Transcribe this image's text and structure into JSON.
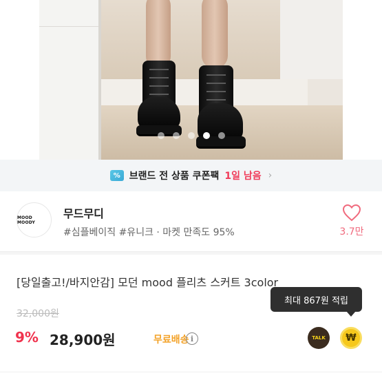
{
  "gallery": {
    "dot_count": 5,
    "active_dot": 4
  },
  "banner": {
    "icon": "%",
    "text": "브랜드 전 상품 쿠폰팩",
    "remaining": "1일 남음",
    "chevron": "›"
  },
  "shop": {
    "logo_text": "MOOD MOODY",
    "name": "무드무디",
    "tags": "#심플베이직 #유니크 · 마켓 만족도 95%",
    "like_count": "3.7만"
  },
  "product": {
    "title": "[당일출고!/바지안감] 모던 mood 플리츠 스커트 3color",
    "original_price": "32,000원",
    "discount": "9%",
    "price": "28,900원",
    "shipping": "무료배송",
    "info_icon": "i"
  },
  "actions": {
    "talk_label": "TALK",
    "point_symbol": "₩"
  },
  "tooltip": {
    "text": "최대 867원 적립"
  },
  "colors": {
    "accent_red": "#f0334e",
    "shipping_orange": "#f3a228",
    "banner_bg": "#f3f5f7"
  }
}
